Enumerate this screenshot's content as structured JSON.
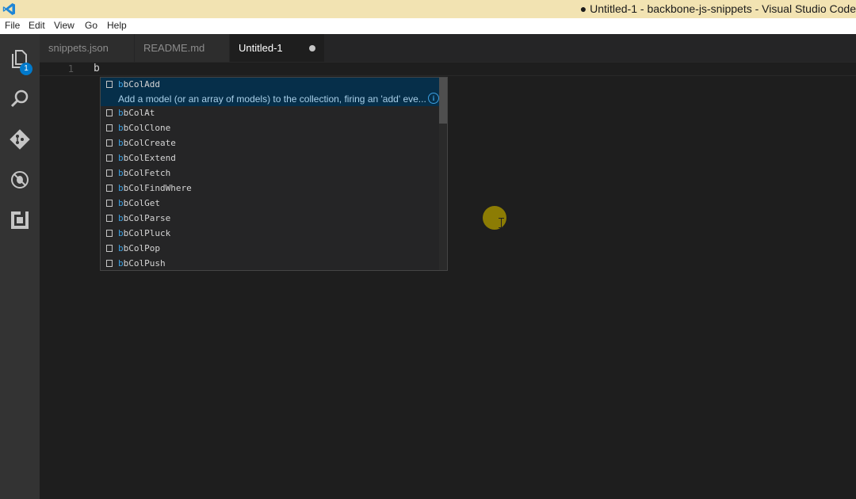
{
  "window": {
    "title": "● Untitled-1 - backbone-js-snippets - Visual Studio Code"
  },
  "menu": [
    "File",
    "Edit",
    "View",
    "Go",
    "Help"
  ],
  "activity": {
    "icons": [
      "explorer-icon",
      "search-icon",
      "git-icon",
      "debug-icon",
      "extensions-icon"
    ],
    "explorer_badge": "1"
  },
  "tabs": [
    {
      "label": "snippets.json",
      "active": false
    },
    {
      "label": "README.md",
      "active": false
    },
    {
      "label": "Untitled-1",
      "active": true,
      "dirty": true
    }
  ],
  "editor": {
    "lines": [
      {
        "number": "1",
        "text": "b"
      }
    ]
  },
  "suggest": {
    "match_prefix": "b",
    "selected": {
      "label": "bbColAdd",
      "doc": "Add a model (or an array of models) to the collection, firing an 'add' eve..."
    },
    "items": [
      "bbColAt",
      "bbColClone",
      "bbColCreate",
      "bbColExtend",
      "bbColFetch",
      "bbColFindWhere",
      "bbColGet",
      "bbColParse",
      "bbColPluck",
      "bbColPop",
      "bbColPush"
    ],
    "info_glyph": "i"
  },
  "colors": {
    "accent": "#007acc",
    "title_bar": "#f2e3b2",
    "editor_bg": "#1e1e1e",
    "match_highlight": "#3c9fe0"
  }
}
